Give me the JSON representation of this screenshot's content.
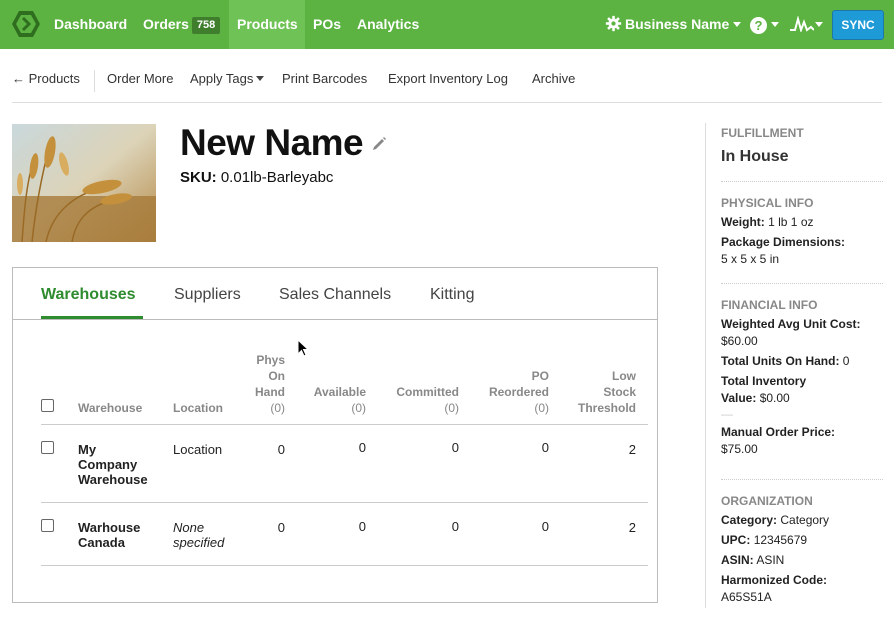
{
  "nav": {
    "items": [
      {
        "label": "Dashboard"
      },
      {
        "label": "Orders",
        "badge": "758"
      },
      {
        "label": "Products"
      },
      {
        "label": "POs"
      },
      {
        "label": "Analytics"
      }
    ],
    "business": "Business Name",
    "help": "?",
    "sync": "SYNC",
    "colors": {
      "bar": "#5cb342",
      "active": "#6ec256",
      "sync": "#1e9ad6"
    }
  },
  "actions": {
    "back": "← Products",
    "order_more": "Order More",
    "apply_tags": "Apply Tags",
    "print_barcodes": "Print Barcodes",
    "export_log": "Export Inventory Log",
    "archive": "Archive"
  },
  "product": {
    "name": "New Name",
    "sku_label": "SKU:",
    "sku": "0.01lb-Barleyabc",
    "image": "wheat-field-photo"
  },
  "tabs": [
    "Warehouses",
    "Suppliers",
    "Sales Channels",
    "Kitting"
  ],
  "table": {
    "headers": {
      "warehouse": "Warehouse",
      "location": "Location",
      "phys": [
        "Phys",
        "On",
        "Hand"
      ],
      "phys_sub": "(0)",
      "available": "Available",
      "available_sub": "(0)",
      "committed": "Committed",
      "committed_sub": "(0)",
      "po": [
        "PO",
        "Reordered"
      ],
      "po_sub": "(0)",
      "low": [
        "Low",
        "Stock",
        "Threshold"
      ]
    },
    "rows": [
      {
        "name": [
          "My",
          "Company",
          "Warehouse"
        ],
        "location": [
          "Location"
        ],
        "phys": "0",
        "available": "0",
        "committed": "0",
        "po": "0",
        "low": "2"
      },
      {
        "name": [
          "Warhouse",
          "Canada"
        ],
        "location": [
          "None",
          "specified"
        ],
        "phys": "0",
        "available": "0",
        "committed": "0",
        "po": "0",
        "low": "2"
      }
    ]
  },
  "sidebar": {
    "fulfillment_head": "FULFILLMENT",
    "fulfillment": "In House",
    "physical_head": "PHYSICAL INFO",
    "weight_label": "Weight:",
    "weight": "1 lb  1 oz",
    "dims_label": "Package Dimensions:",
    "dims": "5 x 5 x 5 in",
    "financial_head": "FINANCIAL INFO",
    "wauc_label": "Weighted Avg Unit Cost:",
    "wauc": "$60.00",
    "units_label": "Total Units On Hand:",
    "units": "0",
    "value_label_1": "Total Inventory",
    "value_label_2": "Value:",
    "value": "$0.00",
    "dash": "—",
    "mop_label": "Manual Order Price:",
    "mop": "$75.00",
    "org_head": "ORGANIZATION",
    "category_label": "Category:",
    "category": "Category",
    "upc_label": "UPC:",
    "upc": "12345679",
    "asin_label": "ASIN:",
    "asin": "ASIN",
    "hc_label": "Harmonized Code:",
    "hc": "A65S51A"
  }
}
